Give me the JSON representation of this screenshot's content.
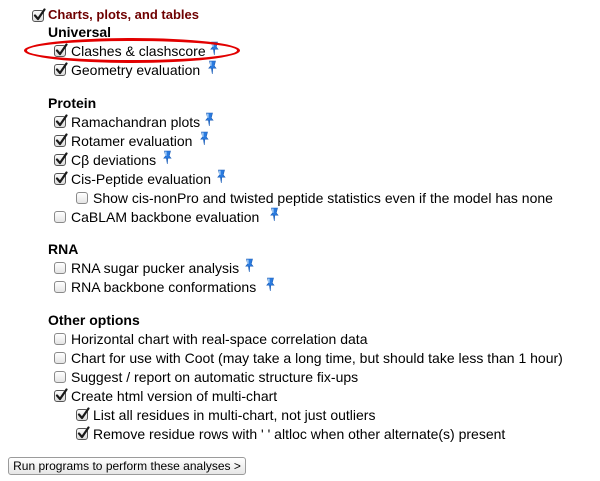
{
  "section_title": "Charts, plots, and tables",
  "groups": {
    "universal": "Universal",
    "protein": "Protein",
    "rna": "RNA",
    "other": "Other options"
  },
  "options": {
    "charts_plots_tables": {
      "checked": true
    },
    "clashes": {
      "label": "Clashes & clashscore",
      "checked": true
    },
    "geometry": {
      "label": "Geometry evaluation",
      "checked": true
    },
    "ramachandran": {
      "label": "Ramachandran plots",
      "checked": true
    },
    "rotamer": {
      "label": "Rotamer evaluation",
      "checked": true
    },
    "cbeta": {
      "label": "Cβ deviations",
      "checked": true
    },
    "cis_peptide": {
      "label": "Cis-Peptide evaluation",
      "checked": true
    },
    "cis_nonpro": {
      "label": "Show cis-nonPro and twisted peptide statistics even if the model has none",
      "checked": false
    },
    "cablam": {
      "label": "CaBLAM backbone evaluation",
      "checked": false
    },
    "rna_pucker": {
      "label": "RNA sugar pucker analysis",
      "checked": false
    },
    "rna_backbone": {
      "label": "RNA backbone conformations",
      "checked": false
    },
    "horizontal_chart": {
      "label": "Horizontal chart with real-space correlation data",
      "checked": false
    },
    "coot_chart": {
      "label": "Chart for use with Coot (may take a long time, but should take less than 1 hour)",
      "checked": false
    },
    "fixups": {
      "label": "Suggest / report on automatic structure fix-ups",
      "checked": false
    },
    "html_multichart": {
      "label": "Create html version of multi-chart",
      "checked": true
    },
    "list_all_residues": {
      "label": "List all residues in multi-chart, not just outliers",
      "checked": true
    },
    "remove_altloc": {
      "label": "Remove residue rows with ' ' altloc when other alternate(s) present",
      "checked": true
    }
  },
  "help_icon": "help-pin-icon",
  "run_button": "Run programs to perform these analyses >",
  "colors": {
    "section_title": "#6e0000",
    "help_icon": "#2a7be0",
    "highlight_oval": "#e20000"
  }
}
